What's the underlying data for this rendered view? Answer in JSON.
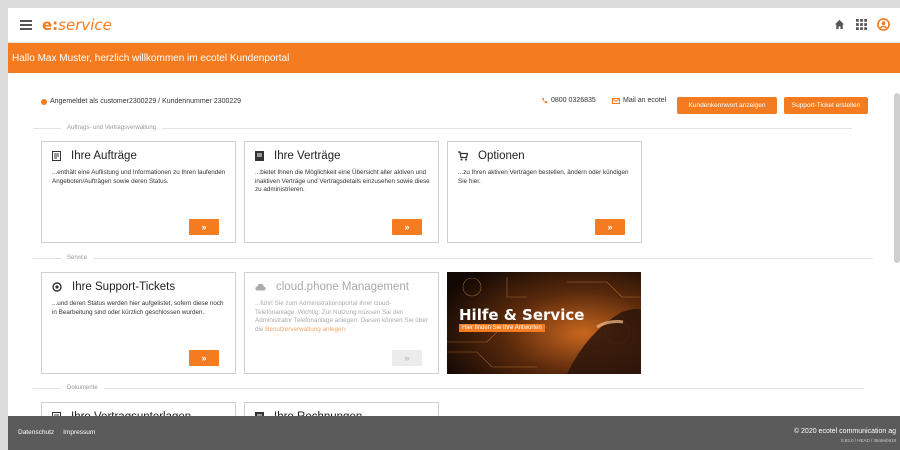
{
  "header": {
    "logo_e": "e:",
    "logo_service": "service"
  },
  "banner": {
    "text": "Hallo Max Muster, herzlich willkommen im ecotel Kundenportal"
  },
  "info": {
    "logged_in": "Angemeldet als customer2300229 / Kundennummer 2300229",
    "phone": "0800 0326835",
    "mail": "Mail an ecotel",
    "btn_password": "Kundenkennwort anzeigen",
    "btn_ticket": "Support-Ticket erstellen"
  },
  "sections": {
    "contracts": "Auftrags- und Vertragsverwaltung",
    "service": "Service",
    "documents": "Dokumente"
  },
  "cards": {
    "orders": {
      "title": "Ihre Aufträge",
      "desc": "...enthält eine Auflistung und Informationen zu Ihren laufenden Angeboten/Aufträgen sowie deren Status.",
      "button": "»"
    },
    "contracts": {
      "title": "Ihre Verträge",
      "desc": "...bietet Ihnen die Möglichkeit eine Übersicht aller aktiven und inaktiven Verträge und Vertragsdetails einzusehen sowie diese zu administrieren.",
      "button": "»"
    },
    "options": {
      "title": "Optionen",
      "desc": "...zu Ihren aktiven Verträgen bestellen, ändern oder kündigen Sie hier.",
      "button": "»"
    },
    "tickets": {
      "title": "Ihre Support-Tickets",
      "desc": "...und deren Status werden hier aufgelistet, sofern diese noch in Bearbeitung sind oder kürzlich geschlossen wurden.",
      "button": "»"
    },
    "cloud": {
      "title": "cloud.phone Management",
      "desc": "...führt Sie zum Administrationsportal Ihrer cloud-Telefonanlage. Wichtig: Zur Nutzung müssen Sie den Administrator Telefonanlage anlegen. Diesen können Sie über die",
      "link": "Benutzerverwaltung anlegen.",
      "button": "»"
    },
    "contract_docs": {
      "title": "Ihre Vertragsunterlagen"
    },
    "invoices": {
      "title": "Ihre Rechnungen"
    }
  },
  "promo": {
    "title": "Hilfe & Service",
    "subtitle": "Hier finden Sie Ihre Antworten"
  },
  "footer": {
    "privacy": "Datenschutz",
    "imprint": "Impressum",
    "copyright": "© 2020 ecotel communication ag",
    "version": "0.93.0 / HEAD / 3646eb918"
  },
  "colors": {
    "accent": "#f47b20",
    "footer": "#5b5b5b"
  }
}
